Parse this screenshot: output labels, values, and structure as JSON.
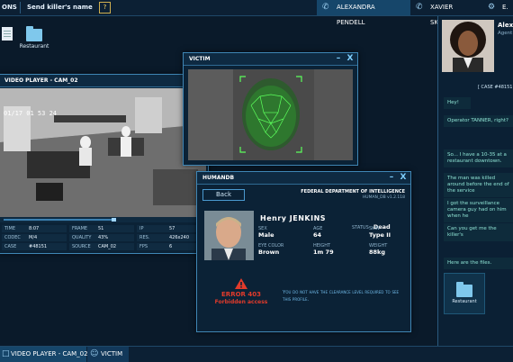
{
  "topbar": {
    "left_label": "ONS",
    "send_label": "Send killer's name",
    "help": "?",
    "tabs": [
      {
        "label": "ALEXANDRA PENDELL",
        "icon": "phone-icon",
        "active": true
      },
      {
        "label": "XAVIER SKINNER",
        "icon": "phone-icon",
        "active": false
      },
      {
        "label": "E. T",
        "icon": "gear-icon",
        "active": false
      }
    ]
  },
  "desktop": {
    "icons": [
      {
        "label": "",
        "icon": "document-icon"
      },
      {
        "label": "Restaurant",
        "icon": "folder-icon"
      }
    ]
  },
  "video_player": {
    "title": "VIDEO PLAYER - CAM_02",
    "timestamp": "01/17 01 53 24",
    "stats": [
      {
        "k": "TIME",
        "v": "8:07"
      },
      {
        "k": "FRAME",
        "v": "51"
      },
      {
        "k": "IP",
        "v": "57"
      },
      {
        "k": "CODEC",
        "v": "M/4"
      },
      {
        "k": "QUALITY",
        "v": "43%"
      },
      {
        "k": "RES.",
        "v": "426x240"
      },
      {
        "k": "CASE",
        "v": "#48151"
      },
      {
        "k": "SOURCE",
        "v": "CAM_02"
      },
      {
        "k": "FPS",
        "v": "6"
      }
    ],
    "progress": 0.3
  },
  "victim_window": {
    "title": "VICTIM",
    "min": "–",
    "close": "X"
  },
  "humandb": {
    "title": "HUMANDB",
    "back": "Back",
    "dept": "FEDERAL DEPARTMENT OF INTELLIGENCE",
    "db": "HUMAN_DB",
    "version": "v1.2.118",
    "first_name": "Henry",
    "last_name": "JENKINS",
    "status_label": "STATUS",
    "status_value": "Dead",
    "fields": [
      {
        "k": "SEX",
        "v": "Male"
      },
      {
        "k": "AGE",
        "v": "64"
      },
      {
        "k": "SKIN",
        "v": "Type II"
      },
      {
        "k": "EYE COLOR",
        "v": "Brown"
      },
      {
        "k": "HEIGHT",
        "v": "1m 79"
      },
      {
        "k": "WEIGHT",
        "v": "88kg"
      }
    ],
    "error_code": "ERROR 403",
    "error_text": "Forbidden access",
    "clearance_msg": "You do not have the clearance level required to see this profile.",
    "min": "–",
    "close": "X"
  },
  "chat": {
    "name": "Alex",
    "role": "Agent",
    "case": "[ CASE #48151",
    "messages": [
      "Hey!",
      "Operator TANNER, right?",
      "So... I have a 10-35 at a restaurant downtown.",
      "The man was killed around before the end of the service",
      "I got the surveillance camera guy had on him when he",
      "Can you get me the killer's",
      "Here are the files."
    ],
    "file_label": "Restaurant"
  },
  "bottombar": {
    "items": [
      {
        "label": "VIDEO PLAYER - CAM_02",
        "icon": "monitor-icon"
      },
      {
        "label": "VICTIM",
        "icon": "face-icon"
      }
    ]
  }
}
